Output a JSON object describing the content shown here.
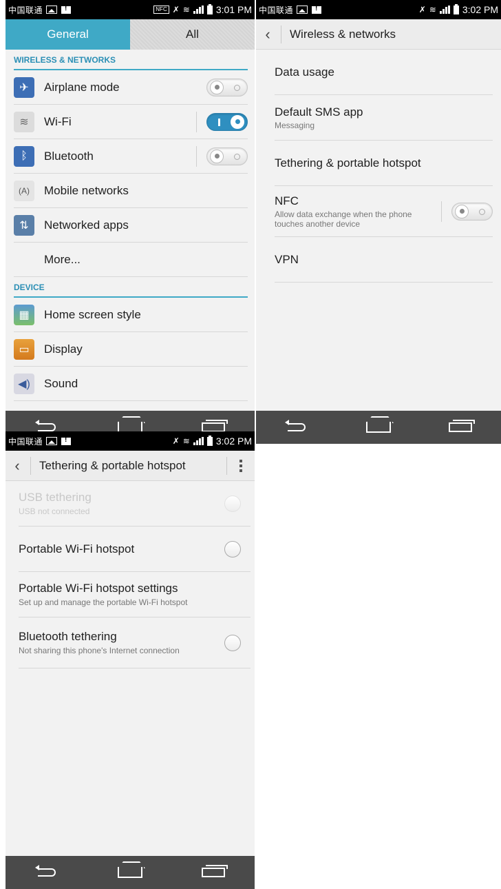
{
  "screen1": {
    "status": {
      "carrier": "中国联通",
      "nfc": "NFC",
      "time": "3:01 PM"
    },
    "tabs": [
      {
        "label": "General"
      },
      {
        "label": "All"
      }
    ],
    "sections": [
      {
        "header": "WIRELESS & NETWORKS",
        "items": [
          {
            "label": "Airplane mode",
            "icon": "airplane-icon",
            "toggle": "off"
          },
          {
            "label": "Wi-Fi",
            "icon": "wifi-icon",
            "toggle": "on"
          },
          {
            "label": "Bluetooth",
            "icon": "bluetooth-icon",
            "toggle": "off"
          },
          {
            "label": "Mobile networks",
            "icon": "antenna-icon"
          },
          {
            "label": "Networked apps",
            "icon": "networked-apps-icon"
          },
          {
            "label": "More..."
          }
        ]
      },
      {
        "header": "DEVICE",
        "items": [
          {
            "label": "Home screen style",
            "icon": "home-screen-icon"
          },
          {
            "label": "Display",
            "icon": "display-icon"
          },
          {
            "label": "Sound",
            "icon": "sound-icon"
          }
        ]
      }
    ]
  },
  "screen2": {
    "status": {
      "carrier": "中国联通",
      "time": "3:02 PM"
    },
    "title": "Wireless & networks",
    "items": [
      {
        "title": "Data usage",
        "subtitle": ""
      },
      {
        "title": "Default SMS app",
        "subtitle": "Messaging"
      },
      {
        "title": "Tethering & portable hotspot",
        "subtitle": ""
      },
      {
        "title": "NFC",
        "subtitle": "Allow data exchange when the phone touches another device",
        "toggle": "off"
      },
      {
        "title": "VPN",
        "subtitle": ""
      }
    ]
  },
  "screen3": {
    "status": {
      "carrier": "中国联通",
      "time": "3:02 PM"
    },
    "title": "Tethering & portable hotspot",
    "items": [
      {
        "title": "USB tethering",
        "subtitle": "USB not connected",
        "radio": true,
        "disabled": true
      },
      {
        "title": "Portable Wi-Fi hotspot",
        "subtitle": "",
        "radio": true
      },
      {
        "title": "Portable Wi-Fi hotspot settings",
        "subtitle": "Set up and manage the portable Wi-Fi hotspot"
      },
      {
        "title": "Bluetooth tethering",
        "subtitle": "Not sharing this phone's Internet connection",
        "radio": true
      }
    ]
  },
  "colors": {
    "accent": "#3fa9c6",
    "toggle_on": "#2f8fc0",
    "navbar": "#4a4a4a",
    "statusbar": "#000000"
  }
}
